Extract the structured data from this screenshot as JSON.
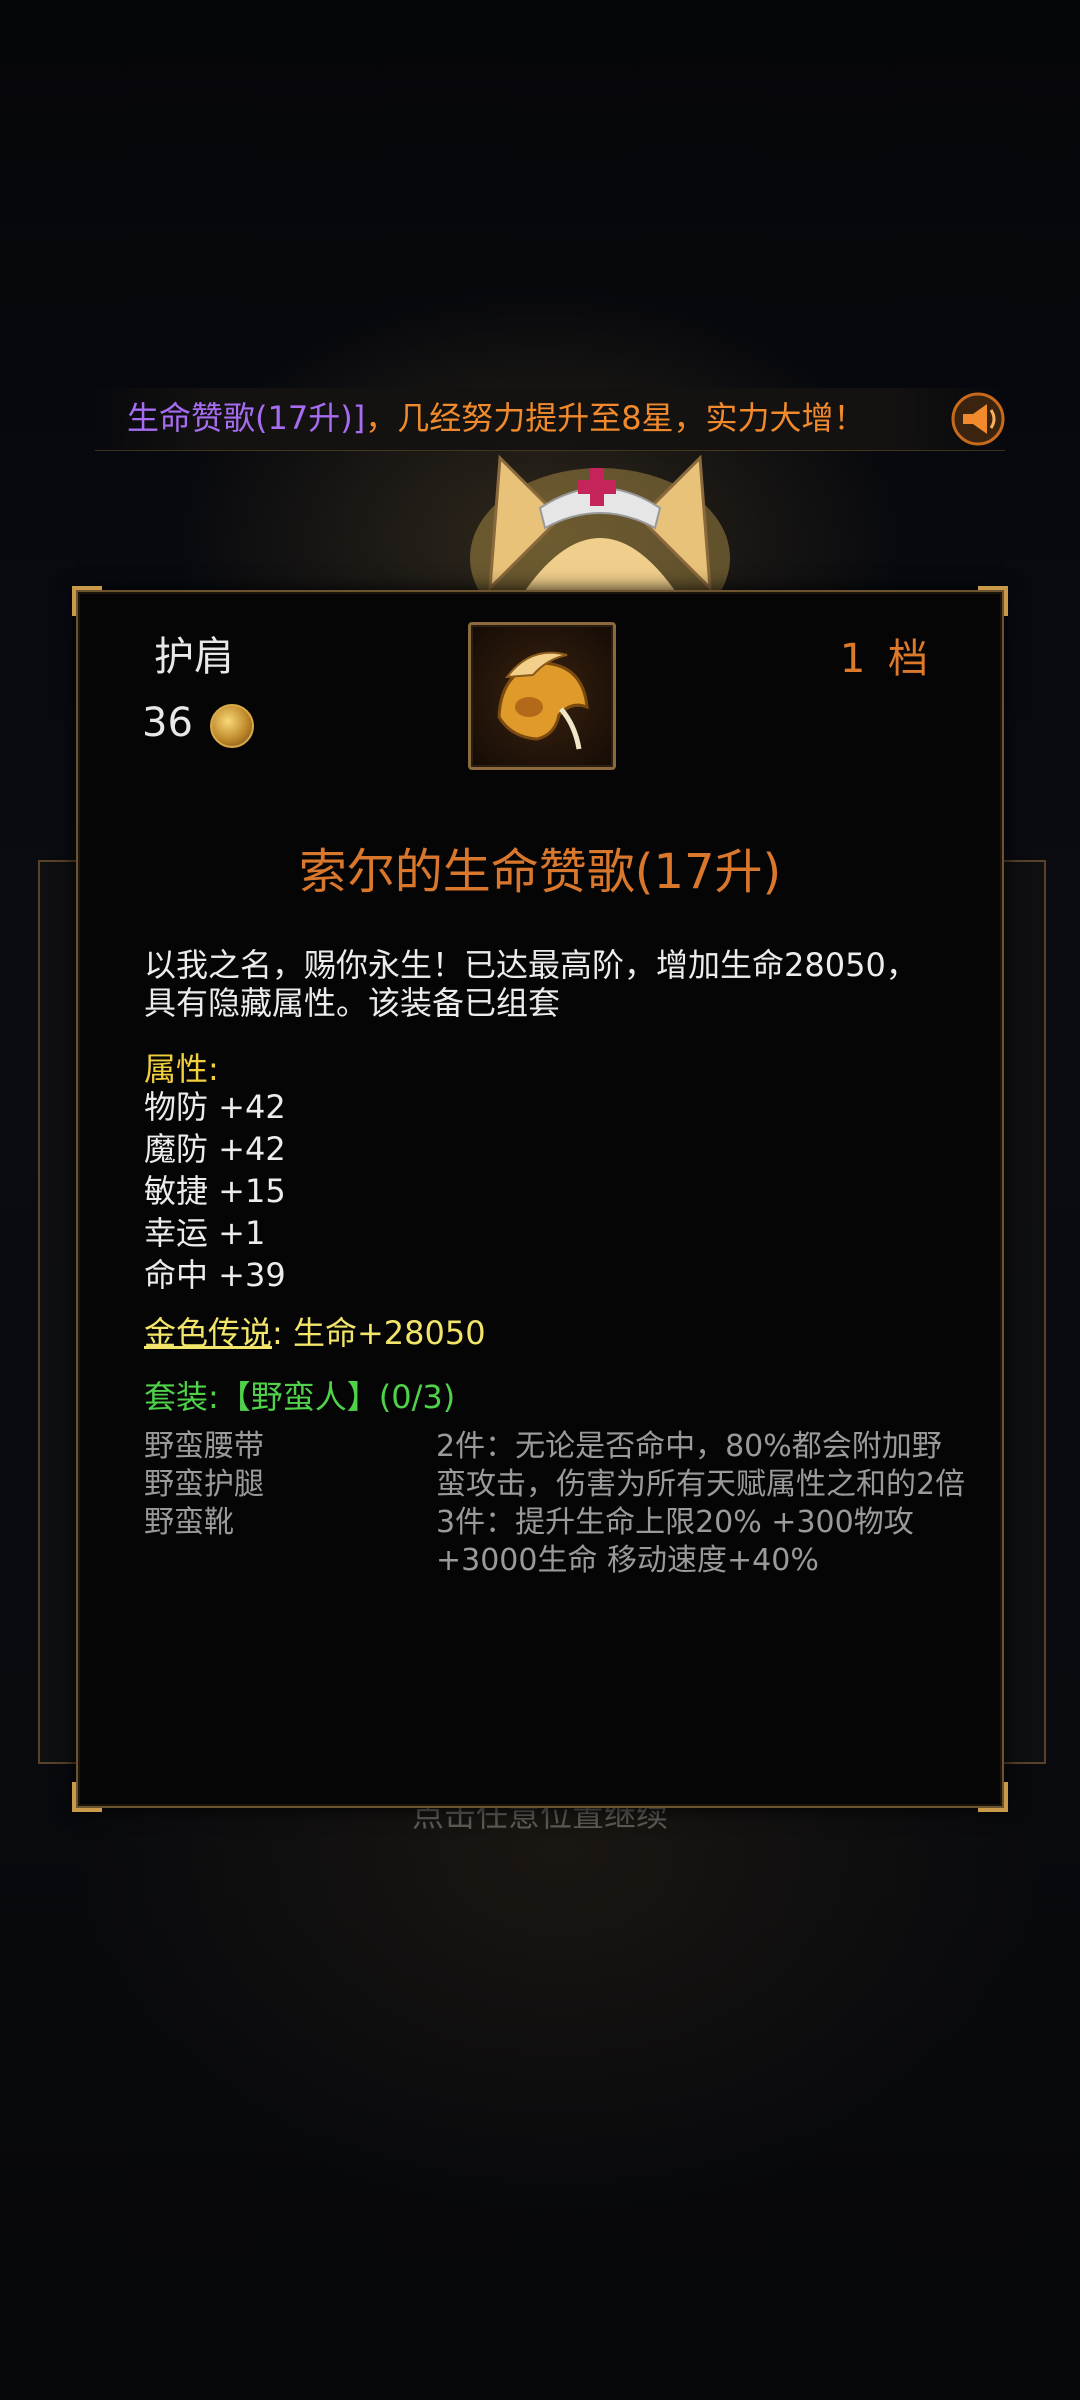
{
  "banner": {
    "item_name": "生命赞歌(17升)]",
    "message": "，几经努力提升至8星，实力大增！",
    "icon": "megaphone-icon"
  },
  "item": {
    "slot": "护肩",
    "price": "36",
    "price_icon": "gold-coin-icon",
    "icon": "helmet-shoulder-icon",
    "tier": "1 档",
    "title": "索尔的生命赞歌(17升)",
    "description": "以我之名，赐你永生！已达最高阶，增加生命28050，具有隐藏属性。该装备已组套",
    "attributes_label": "属性:",
    "attributes": [
      "物防 +42",
      "魔防 +42",
      "敏捷 +15",
      "幸运 +1",
      "命中 +39"
    ],
    "legend_key": "金色传说",
    "legend_colon": ":",
    "legend_value": " 生命+28050",
    "set_title": "套装:【野蛮人】(0/3)",
    "set_pieces": [
      "野蛮腰带",
      "野蛮护腿",
      "野蛮靴"
    ],
    "set_bonus_2": "2件：无论是否命中，80%都会附加野蛮攻击，伤害为所有天赋属性之和的2倍",
    "set_bonus_3": "3件：提升生命上限20% +300物攻 +3000生命 移动速度+40%"
  },
  "hint": "点击任意位置继续",
  "colors": {
    "accent_orange": "#d9772c",
    "set_green": "#4fd14a",
    "attr_yellow": "#f2cf3c",
    "banner_purple": "#a66cf2"
  }
}
